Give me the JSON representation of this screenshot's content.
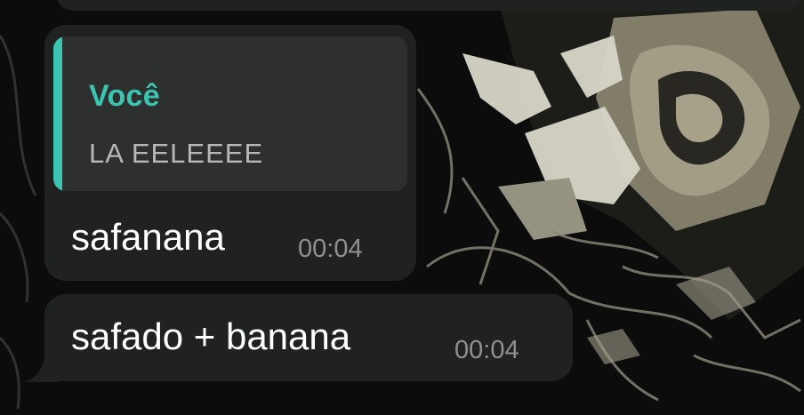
{
  "messages": [
    {
      "reply": {
        "author": "Você",
        "text": "LA EELEEEE"
      },
      "text": "safanana",
      "time": "00:04"
    },
    {
      "text": "safado + banana",
      "time": "00:04"
    }
  ],
  "colors": {
    "bubble": "#202221",
    "quote_background": "#2d302f",
    "quote_accent": "#3bc4b0",
    "timestamp": "#8d918f"
  }
}
